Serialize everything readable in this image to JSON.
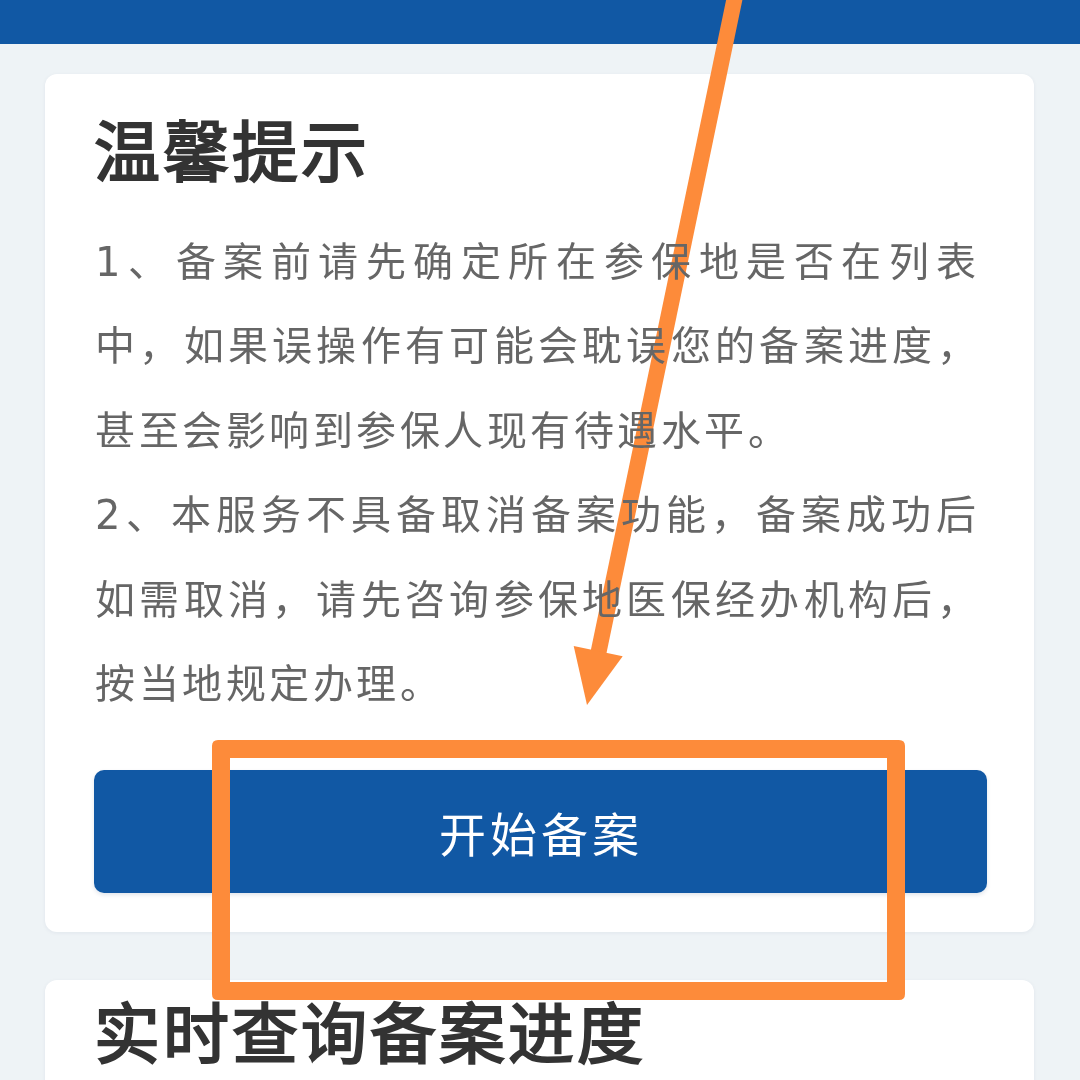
{
  "notice_card": {
    "title": "温馨提示",
    "paragraphs": [
      "1、备案前请先确定所在参保地是否在列表中，如果误操作有可能会耽误您的备案进度，甚至会影响到参保人现有待遇水平。",
      "2、本服务不具备取消备案功能，备案成功后如需取消，请先咨询参保地医保经办机构后，按当地规定办理。"
    ],
    "button": "开始备案"
  },
  "progress_card": {
    "title": "实时查询备案进度"
  }
}
